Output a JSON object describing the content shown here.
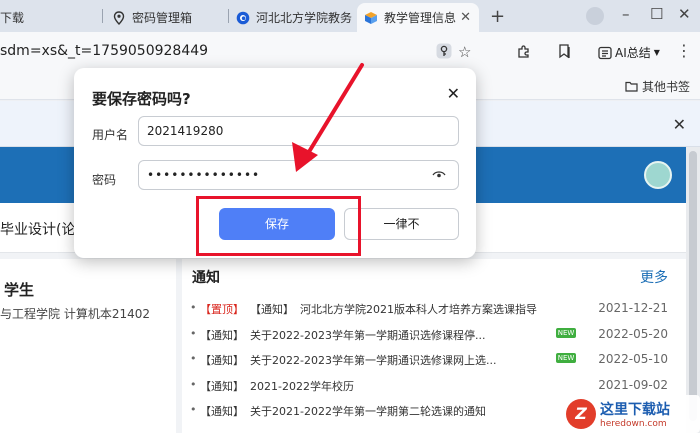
{
  "browser": {
    "tabs": [
      {
        "label": "下载",
        "active": false
      },
      {
        "label": "密码管理箱",
        "active": false
      },
      {
        "label": "河北北方学院教务",
        "active": false
      },
      {
        "label": "教学管理信息",
        "active": true
      }
    ],
    "address_url": "sdm=xs&_t=1759050928449",
    "ai_summary_label": "AI总结",
    "bookmarks_other": "其他书签"
  },
  "page": {
    "subnav_text": "毕业设计(论文",
    "student_title": "学生",
    "student_info": "与工程学院 计算机本21402",
    "notice": {
      "title": "通知",
      "more": "更多",
      "items": [
        {
          "tag": "【置顶】",
          "tag2": "【通知】",
          "text": "河北北方学院2021版本科人才培养方案选课指导",
          "date": "2021-12-21",
          "new": false
        },
        {
          "tag": "【通知】",
          "tag2": "",
          "text": "关于2022-2023学年第一学期通识选修课程停...",
          "date": "2022-05-20",
          "new": true
        },
        {
          "tag": "【通知】",
          "tag2": "",
          "text": "关于2022-2023学年第一学期通识选修课网上选...",
          "date": "2022-05-10",
          "new": true
        },
        {
          "tag": "【通知】",
          "tag2": "",
          "text": "2021-2022学年校历",
          "date": "2021-09-02",
          "new": false
        },
        {
          "tag": "【通知】",
          "tag2": "",
          "text": "关于2021-2022学年第一学期第二轮选课的通知",
          "date": "",
          "new": false
        }
      ],
      "new_badge": "NEW"
    }
  },
  "dialog": {
    "title": "要保存密码吗?",
    "username_label": "用户名",
    "username_value": "2021419280",
    "password_label": "密码",
    "password_value": "••••••••••••••",
    "save_label": "保存",
    "never_label": "一律不"
  },
  "watermark": {
    "logo": "Z",
    "title": "这里下载站",
    "sub": "heredown.com"
  },
  "colors": {
    "accent": "#4f7ff7",
    "hero": "#1d6fb6",
    "annotation_red": "#e8132b",
    "pin_red": "#d9251c"
  },
  "icons": [
    "key-icon",
    "star-icon",
    "extensions-icon",
    "bookmark-icon",
    "ai-summary-icon",
    "folder-icon",
    "eye-icon",
    "close-icon",
    "plus-icon"
  ]
}
